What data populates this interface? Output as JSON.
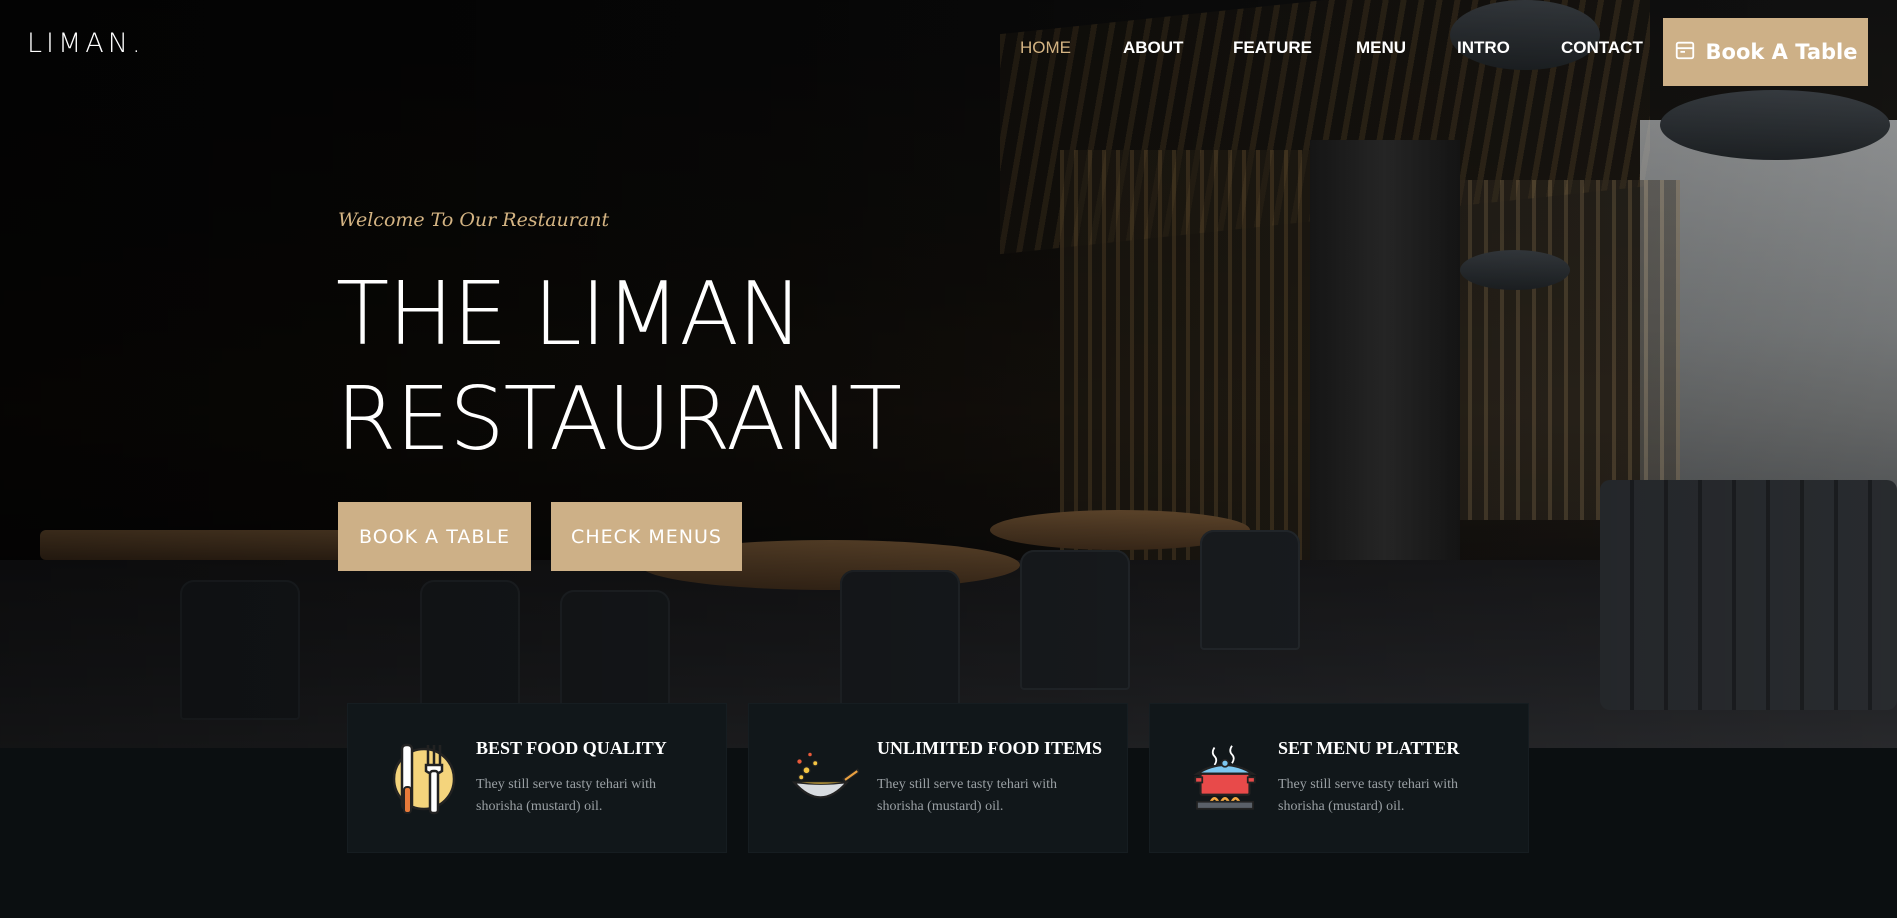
{
  "brand": {
    "logo": "LIMAN."
  },
  "nav": {
    "items": [
      "HOME",
      "ABOUT",
      "FEATURE",
      "MENU",
      "INTRO",
      "CONTACT"
    ],
    "active": "HOME",
    "book_label": "Book A Table"
  },
  "hero": {
    "welcome": "Welcome To Our Restaurant",
    "title_line1": "THE LIMAN",
    "title_line2": "RESTAURANT",
    "btn_book": "BOOK A TABLE",
    "btn_menus": "CHECK MENUS"
  },
  "features": [
    {
      "icon": "cutlery-icon",
      "title": "BEST FOOD QUALITY",
      "desc": "They still serve tasty tehari with shorisha (mustard) oil."
    },
    {
      "icon": "wok-icon",
      "title": "UNLIMITED FOOD ITEMS",
      "desc": "They still serve tasty tehari with shorisha (mustard) oil."
    },
    {
      "icon": "cooking-pot-icon",
      "title": "SET MENU PLATTER",
      "desc": "They still serve tasty tehari with shorisha (mustard) oil."
    }
  ],
  "colors": {
    "accent": "#cdb087",
    "active_nav": "#d4b483",
    "card_bg": "#11171a",
    "page_bg": "#0b0f11"
  }
}
